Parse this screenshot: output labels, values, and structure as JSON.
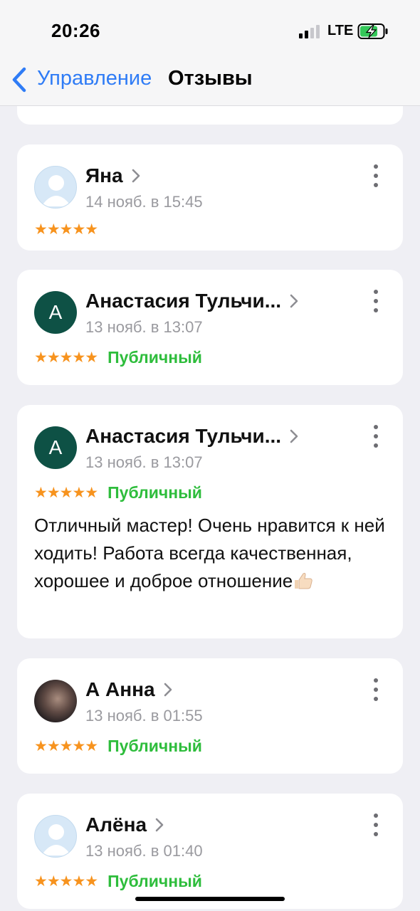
{
  "status_bar": {
    "time": "20:26",
    "network": "LTE",
    "battery_icon": "battery-charging-icon"
  },
  "nav": {
    "back_label": "Управление",
    "title": "Отзывы"
  },
  "reviews": [
    {
      "name": "Яна",
      "date": "14 нояб. в 15:45",
      "rating": 5,
      "stars": "★★★★★",
      "status": "",
      "avatar": "placeholder",
      "avatar_letter": "",
      "text": ""
    },
    {
      "name": "Анастасия Тульчи...",
      "date": "13 нояб. в 13:07",
      "rating": 5,
      "stars": "★★★★★",
      "status": "Публичный",
      "avatar": "letter",
      "avatar_letter": "А",
      "text": ""
    },
    {
      "name": "Анастасия Тульчи...",
      "date": "13 нояб. в 13:07",
      "rating": 5,
      "stars": "★★★★★",
      "status": "Публичный",
      "avatar": "letter",
      "avatar_letter": "А",
      "text": "Отличный мастер! Очень нравится к ней ходить! Работа всегда качественная, хорошее и доброе отношение"
    },
    {
      "name": "А Анна",
      "date": "13 нояб. в 01:55",
      "rating": 5,
      "stars": "★★★★★",
      "status": "Публичный",
      "avatar": "photo",
      "avatar_letter": "",
      "text": ""
    },
    {
      "name": "Алёна",
      "date": "13 нояб. в 01:40",
      "rating": 5,
      "stars": "★★★★★",
      "status": "Публичный",
      "avatar": "placeholder",
      "avatar_letter": "",
      "text": ""
    }
  ],
  "colors": {
    "accent": "#2f7cf6",
    "star": "#f7931e",
    "status_public": "#2ebd3c",
    "avatar_letter_bg": "#0e5145",
    "background": "#efeff4"
  }
}
